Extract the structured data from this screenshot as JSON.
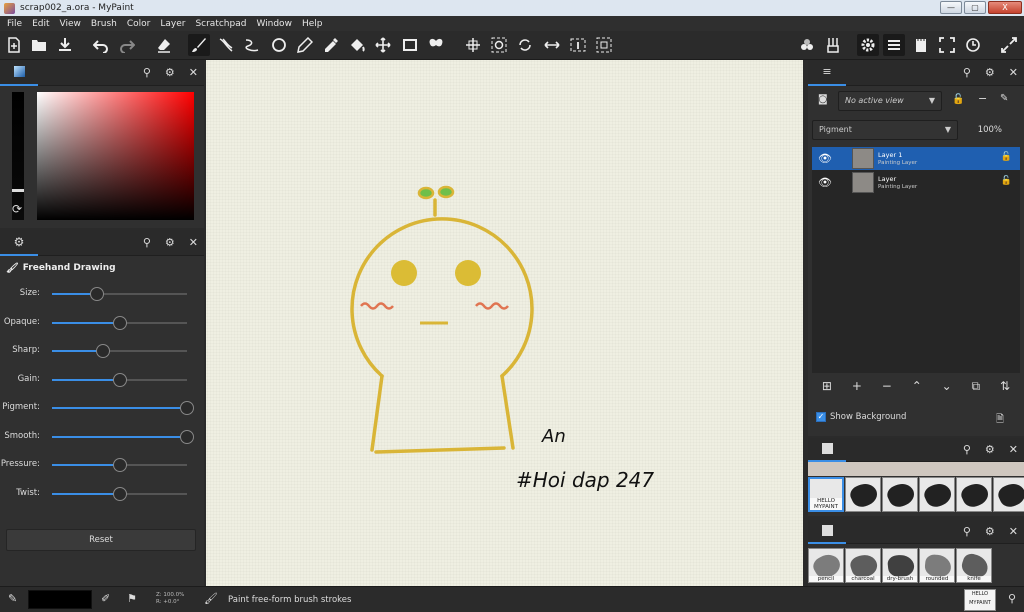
{
  "window": {
    "title": "scrap002_a.ora - MyPaint",
    "controls": [
      "—",
      "▢",
      "X"
    ]
  },
  "menu": [
    "File",
    "Edit",
    "View",
    "Brush",
    "Color",
    "Layer",
    "Scratchpad",
    "Window",
    "Help"
  ],
  "toolbar": {
    "icons": [
      "new-document-icon",
      "open-icon",
      "save-icon",
      "undo-icon",
      "redo-icon",
      "eraser-icon",
      "freehand-brush-icon",
      "inking-icon",
      "line-icon",
      "ellipse-icon",
      "pen-icon",
      "color-picker-icon",
      "fill-icon",
      "move-layer-icon",
      "frame-icon",
      "symmetry-icon",
      "pan-icon",
      "zoom-icon",
      "rotate-icon",
      "mirror-icon",
      "reset-zoom-icon",
      "fit-view-icon",
      "brush-settings-icon",
      "brushes-icon",
      "preferences-icon",
      "layers-menu-icon",
      "scratchpad-icon",
      "fullscreen-icon",
      "clock-icon",
      "expand-icon"
    ]
  },
  "color_panel": {
    "hue_color": "#ff0000"
  },
  "brush_panel": {
    "title": "Freehand Drawing",
    "sliders": [
      {
        "label": "Size:",
        "value": 0.33
      },
      {
        "label": "Opaque:",
        "value": 0.5
      },
      {
        "label": "Sharp:",
        "value": 0.38
      },
      {
        "label": "Gain:",
        "value": 0.5
      },
      {
        "label": "Pigment:",
        "value": 1.0
      },
      {
        "label": "Smooth:",
        "value": 1.0
      },
      {
        "label": "Pressure:",
        "value": 0.5
      },
      {
        "label": "Twist:",
        "value": 0.5
      }
    ],
    "reset_label": "Reset"
  },
  "canvas": {
    "text_an": "An",
    "text_tag": "#Hoi dap 247",
    "stroke_yellow": "#d9b537",
    "eye_yellow": "#dbbc35",
    "blush": "#e07552",
    "leaf_green": "#6fbf4a"
  },
  "layers_panel": {
    "view_placeholder": "No active view",
    "mode": "Pigment",
    "opacity": "100%",
    "layers": [
      {
        "name": "Layer 1",
        "type": "Painting Layer",
        "selected": true
      },
      {
        "name": "Layer",
        "type": "Painting Layer",
        "selected": false
      }
    ],
    "show_background_label": "Show Background"
  },
  "brush_groups": {
    "group1": [
      "HELLO MYPAINT",
      "",
      "",
      "",
      "",
      ""
    ],
    "group2": [
      "pencil",
      "charcoal",
      "dry-brush",
      "rounded",
      "knife"
    ]
  },
  "statusbar": {
    "zoom_line1": "Z: 100.0%",
    "zoom_line2": "R: +0.0°",
    "message": "Paint free-form brush strokes",
    "preview_text": "HELLO MYPAINT"
  }
}
